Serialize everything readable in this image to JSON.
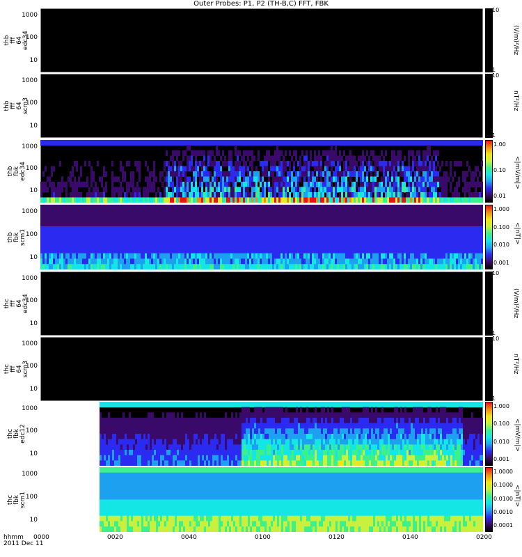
{
  "title": "Outer Probes: P1, P2 (TH-B,C) FFT, FBK",
  "x_axis": {
    "row1": "hhmm",
    "row2": "2011 Dec 11",
    "ticks": [
      "0000",
      "0020",
      "0040",
      "0100",
      "0120",
      "0140",
      "0200"
    ]
  },
  "panels": [
    {
      "id": "p1",
      "label": [
        "thb",
        "fff",
        "64",
        "edc34"
      ],
      "yticks": [
        "10",
        "100",
        "1000"
      ],
      "ctop": "10",
      "cbot": "1",
      "unit": "(V/m)²/Hz",
      "style": "empty"
    },
    {
      "id": "p2",
      "label": [
        "thb",
        "fff",
        "64",
        "scm3"
      ],
      "yticks": [
        "10",
        "100",
        "1000"
      ],
      "ctop": "10",
      "cbot": "1",
      "unit": "nT²/Hz",
      "style": "empty"
    },
    {
      "id": "p3",
      "label": [
        "thb",
        "fbk",
        "edc34"
      ],
      "yticks": [
        "10",
        "100",
        "1000"
      ],
      "cticks": [
        "1.00",
        "0.10",
        "0.01"
      ],
      "unit": "<|mV/m|>",
      "style": "fbk_e"
    },
    {
      "id": "p4",
      "label": [
        "thb",
        "fbk",
        "scm1"
      ],
      "yticks": [
        "10",
        "100",
        "1000"
      ],
      "cticks": [
        "1.000",
        "0.100",
        "0.010",
        "0.001"
      ],
      "unit": "<|nT|>",
      "style": "fbk_b"
    },
    {
      "id": "p5",
      "label": [
        "thc",
        "fff",
        "64",
        "edc34"
      ],
      "yticks": [
        "10",
        "100",
        "1000"
      ],
      "ctop": "10",
      "cbot": "1",
      "unit": "(V/m)²/Hz",
      "style": "empty"
    },
    {
      "id": "p6",
      "label": [
        "thc",
        "fff",
        "64",
        "scm3"
      ],
      "yticks": [
        "10",
        "100",
        "1000"
      ],
      "ctop": "10",
      "cbot": "1",
      "unit": "nT²/Hz",
      "style": "empty"
    },
    {
      "id": "p7",
      "label": [
        "thc",
        "fbk",
        "edc12"
      ],
      "yticks": [
        "10",
        "100",
        "1000"
      ],
      "cticks": [
        "1.000",
        "0.100",
        "0.010",
        "0.001"
      ],
      "unit": "<|mV/m|>",
      "style": "fbk_e2"
    },
    {
      "id": "p8",
      "label": [
        "thc",
        "fbk",
        "scm1"
      ],
      "yticks": [
        "10",
        "100",
        "1000"
      ],
      "cticks": [
        "1.0000",
        "0.1000",
        "0.0100",
        "0.0010",
        "0.0001"
      ],
      "unit": "<|nT|>",
      "style": "fbk_b2"
    }
  ],
  "chart_data": {
    "type": "heatmap",
    "title": "Outer Probes: P1, P2 (TH-B,C) FFT, FBK",
    "x_range": [
      "0000",
      "0200"
    ],
    "y_scale": "log",
    "y_range_hz": [
      3,
      2000
    ],
    "data_gap_thc_fbk_until": "0016",
    "colorscale": [
      "#000000",
      "#3a0a6a",
      "#2a2af0",
      "#1ea0f0",
      "#14e6e6",
      "#3cf08c",
      "#c8f03c",
      "#f0e614",
      "#f08c14",
      "#e61414"
    ]
  }
}
